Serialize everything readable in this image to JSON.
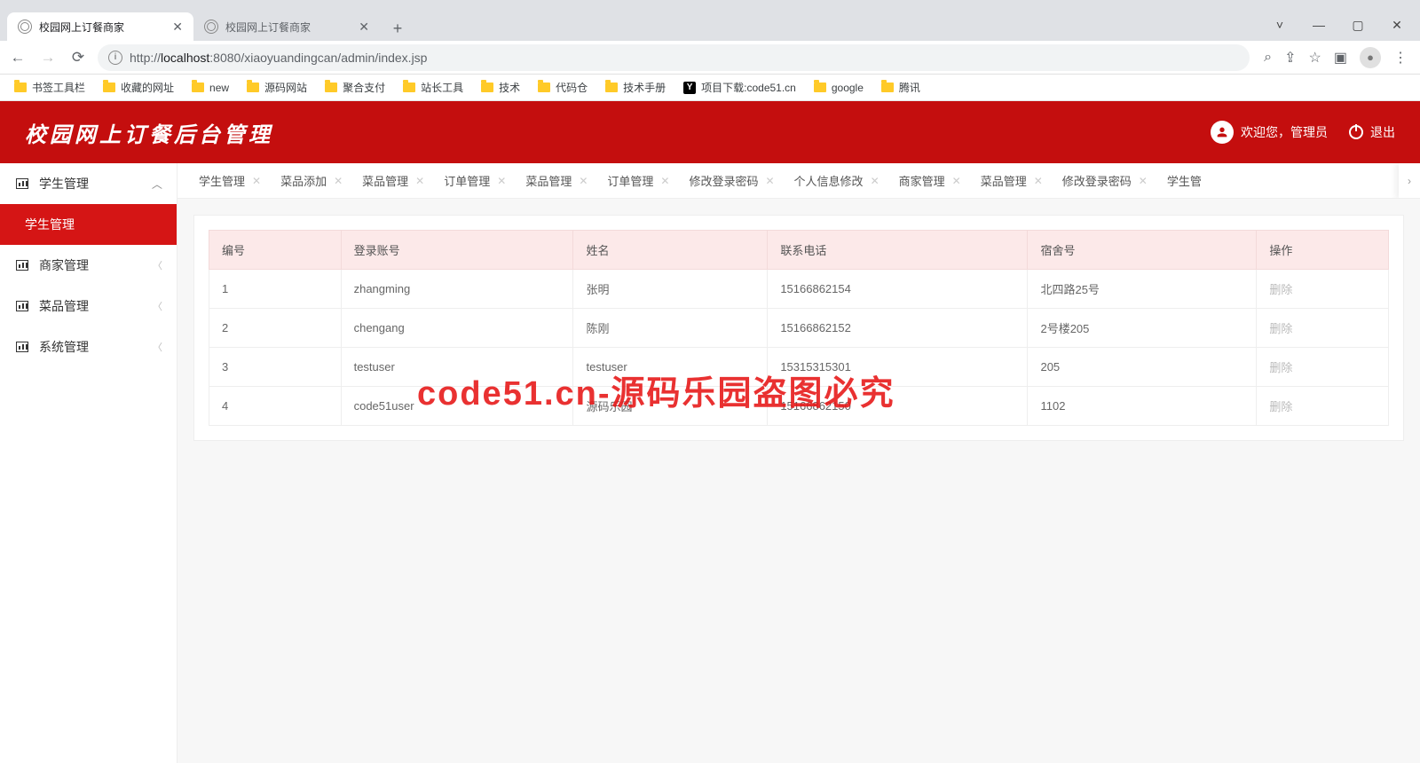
{
  "browser": {
    "tabs": [
      {
        "title": "校园网上订餐商家",
        "active": true
      },
      {
        "title": "校园网上订餐商家",
        "active": false
      }
    ],
    "url_prefix": "http://",
    "url_host": "localhost",
    "url_port_path": ":8080/xiaoyuandingcan/admin/index.jsp",
    "bookmarks": [
      {
        "label": "书签工具栏",
        "icon": "folder"
      },
      {
        "label": "收藏的网址",
        "icon": "folder"
      },
      {
        "label": "new",
        "icon": "folder"
      },
      {
        "label": "源码网站",
        "icon": "folder"
      },
      {
        "label": "聚合支付",
        "icon": "folder"
      },
      {
        "label": "站长工具",
        "icon": "folder"
      },
      {
        "label": "技术",
        "icon": "folder"
      },
      {
        "label": "代码仓",
        "icon": "folder"
      },
      {
        "label": "技术手册",
        "icon": "folder"
      },
      {
        "label": "项目下载:code51.cn",
        "icon": "y"
      },
      {
        "label": "google",
        "icon": "folder"
      },
      {
        "label": "腾讯",
        "icon": "folder"
      }
    ]
  },
  "app": {
    "title": "校园网上订餐后台管理",
    "welcome": "欢迎您，管理员",
    "logout": "退出"
  },
  "sidebar": {
    "items": [
      {
        "label": "学生管理",
        "active": false,
        "top": true
      },
      {
        "label": "学生管理",
        "active": true
      },
      {
        "label": "商家管理",
        "active": false
      },
      {
        "label": "菜品管理",
        "active": false
      },
      {
        "label": "系统管理",
        "active": false
      }
    ]
  },
  "content_tabs": [
    "学生管理",
    "菜品添加",
    "菜品管理",
    "订单管理",
    "菜品管理",
    "订单管理",
    "修改登录密码",
    "个人信息修改",
    "商家管理",
    "菜品管理",
    "修改登录密码",
    "学生管"
  ],
  "table": {
    "headers": [
      "编号",
      "登录账号",
      "姓名",
      "联系电话",
      "宿舍号",
      "操作"
    ],
    "rows": [
      {
        "cells": [
          "1",
          "zhangming",
          "张明",
          "15166862154",
          "北四路25号"
        ],
        "action": "删除"
      },
      {
        "cells": [
          "2",
          "chengang",
          "陈刚",
          "15166862152",
          "2号楼205"
        ],
        "action": "删除"
      },
      {
        "cells": [
          "3",
          "testuser",
          "testuser",
          "15315315301",
          "205"
        ],
        "action": "删除"
      },
      {
        "cells": [
          "4",
          "code51user",
          "源码乐园",
          "15166862150",
          "1102"
        ],
        "action": "删除"
      }
    ]
  },
  "watermark": "code51.cn-源码乐园盗图必究"
}
